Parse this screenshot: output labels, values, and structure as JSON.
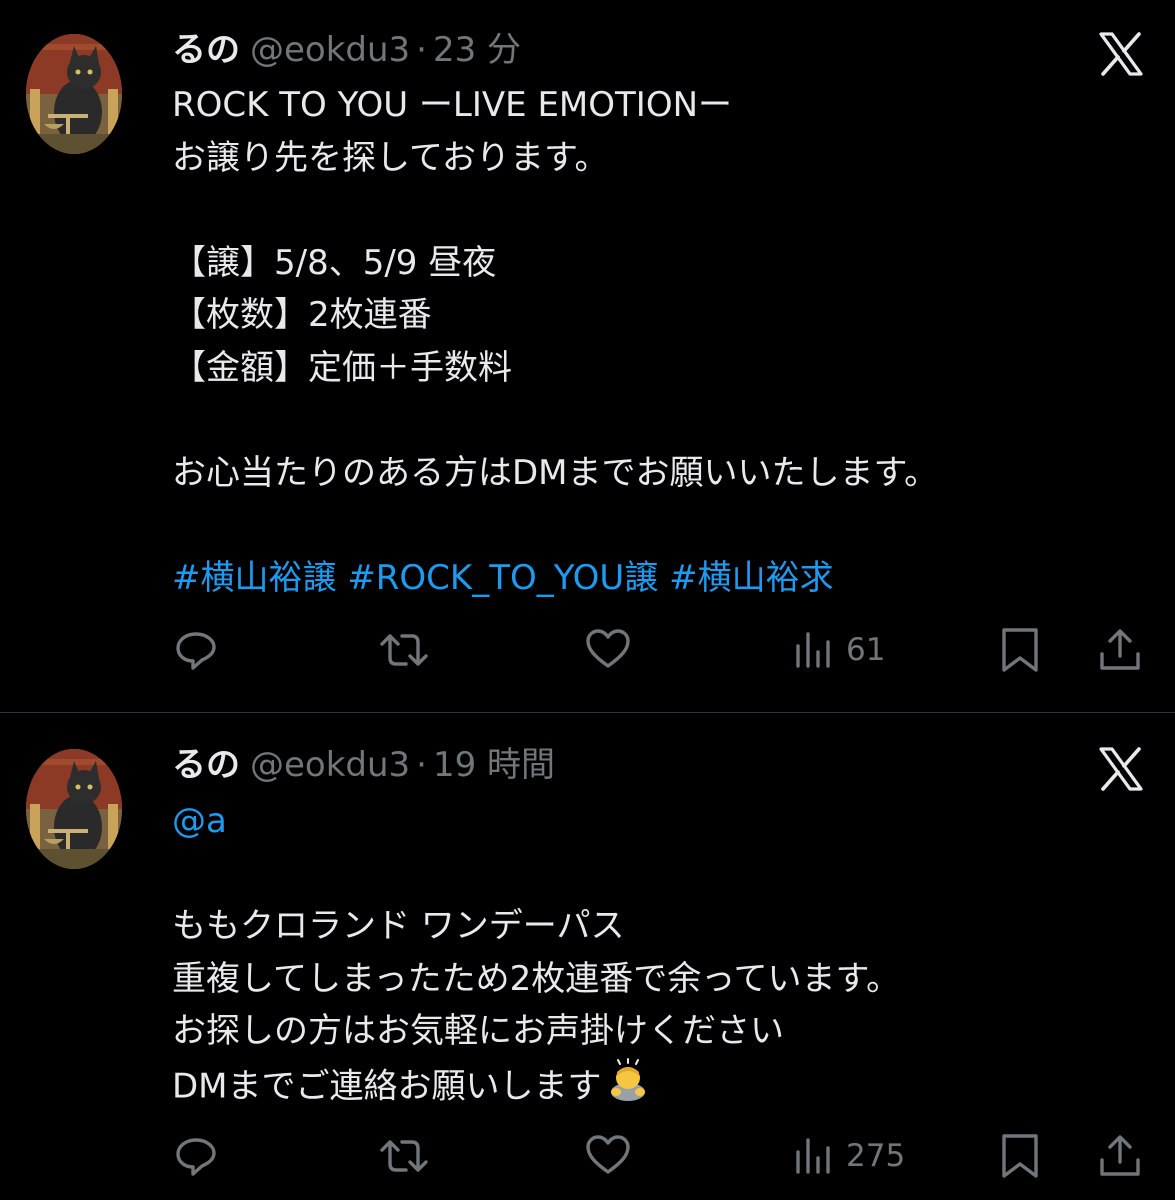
{
  "tweets": [
    {
      "display_name": "るの",
      "handle": "@eokdu3",
      "separator": "·",
      "time": "23 分",
      "lines": [
        "ROCK TO YOU ーLIVE EMOTIONー",
        "お譲り先を探しております。",
        "",
        "【譲】5/8、5/9 昼夜",
        "【枚数】2枚連番",
        "【金額】定価＋手数料",
        "",
        "お心当たりのある方はDMまでお願いいたします。",
        ""
      ],
      "hashtags": [
        "#横山裕譲",
        "#ROCK_TO_YOU譲",
        "#横山裕求"
      ],
      "views": "61"
    },
    {
      "display_name": "るの",
      "handle": "@eokdu3",
      "separator": "·",
      "time": "19 時間",
      "mention": "@a",
      "lines": [
        "",
        "ももクロランド ワンデーパス",
        "重複してしまったため2枚連番で余っています。",
        "お探しの方はお気軽にお声掛けください",
        "DMまでご連絡お願いします"
      ],
      "emoji": "person-bowing",
      "views": "275"
    }
  ],
  "colors": {
    "background": "#000000",
    "text": "#e7e9ea",
    "secondary": "#71767b",
    "link": "#1d9bf0",
    "divider": "#2f3336"
  },
  "icons": [
    "reply-icon",
    "retweet-icon",
    "like-icon",
    "views-icon",
    "bookmark-icon",
    "share-icon",
    "x-logo-icon"
  ]
}
